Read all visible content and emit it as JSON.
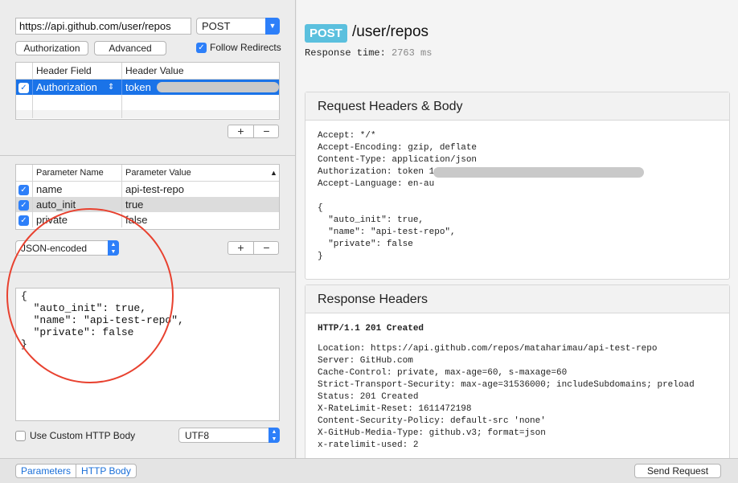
{
  "request": {
    "url": "https://api.github.com/user/repos",
    "method": "POST",
    "authorization_button": "Authorization",
    "advanced_button": "Advanced",
    "follow_redirects_label": "Follow Redirects"
  },
  "headers_table": {
    "col_field": "Header Field",
    "col_value": "Header Value",
    "rows": [
      {
        "field": "Authorization",
        "value": "token"
      }
    ]
  },
  "params_table": {
    "col_name": "Parameter Name",
    "col_value": "Parameter Value",
    "rows": [
      {
        "name": "name",
        "value": "api-test-repo"
      },
      {
        "name": "auto_init",
        "value": "true"
      },
      {
        "name": "private",
        "value": "false"
      }
    ]
  },
  "encoding_select": "JSON-encoded",
  "body_text": "{\n  \"auto_init\": true,\n  \"name\": \"api-test-repo\",\n  \"private\": false\n}",
  "custom_body_label": "Use Custom HTTP Body",
  "charset_select": "UTF8",
  "bottom": {
    "tab_parameters": "Parameters",
    "tab_http_body": "HTTP Body",
    "send_button": "Send Request"
  },
  "response": {
    "method_badge": "POST",
    "path": "/user/repos",
    "time_label": "Response time:",
    "time_value": "2763 ms",
    "request_panel_title": "Request Headers & Body",
    "request_lines": [
      "Accept: */*",
      "Accept-Encoding: gzip, deflate",
      "Content-Type: application/json",
      "Authorization: token 1",
      "Accept-Language: en-au",
      "",
      "{",
      "  \"auto_init\": true,",
      "  \"name\": \"api-test-repo\",",
      "  \"private\": false",
      "}"
    ],
    "response_panel_title": "Response Headers",
    "status_line": "HTTP/1.1 201 Created",
    "response_lines": [
      "Location: https://api.github.com/repos/mataharimau/api-test-repo",
      "Server: GitHub.com",
      "Cache-Control: private, max-age=60, s-maxage=60",
      "Strict-Transport-Security: max-age=31536000; includeSubdomains; preload",
      "Status: 201 Created",
      "X-RateLimit-Reset: 1611472198",
      "Content-Security-Policy: default-src 'none'",
      "X-GitHub-Media-Type: github.v3; format=json",
      "x-ratelimit-used: 2"
    ]
  },
  "colors": {
    "accent": "#2d7ff9",
    "selection": "#1a73e8",
    "badge": "#5bc0de",
    "annotation": "#e8412f"
  }
}
